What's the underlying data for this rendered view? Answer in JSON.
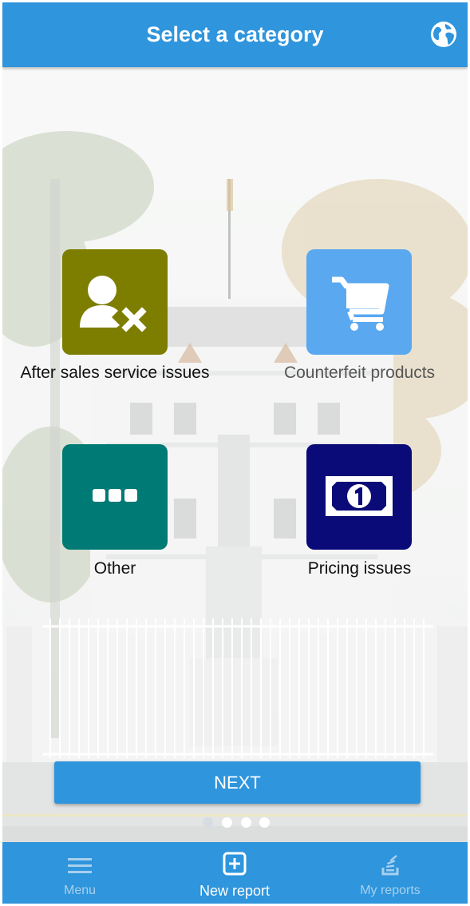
{
  "header": {
    "title": "Select a category",
    "globe_icon": "globe-icon"
  },
  "categories": [
    {
      "label": "After sales service issues",
      "icon": "user-remove-icon",
      "color": "#7d7d00"
    },
    {
      "label": "Counterfeit products",
      "icon": "shopping-cart-icon",
      "color": "#5aa8f0"
    },
    {
      "label": "Other",
      "icon": "more-dots-icon",
      "color": "#007a74"
    },
    {
      "label": "Pricing issues",
      "icon": "banknote-icon",
      "color": "#0a0a78"
    }
  ],
  "next_button": {
    "label": "NEXT"
  },
  "pager": {
    "active_index": 0,
    "count": 4
  },
  "tabbar": {
    "items": [
      {
        "label": "Menu",
        "icon": "hamburger-menu-icon",
        "active": false
      },
      {
        "label": "New report",
        "icon": "plus-square-icon",
        "active": true
      },
      {
        "label": "My reports",
        "icon": "reports-stack-icon",
        "active": false
      }
    ]
  },
  "colors": {
    "primary": "#2f95dc",
    "tab_inactive_text": "#a7d0ee"
  }
}
